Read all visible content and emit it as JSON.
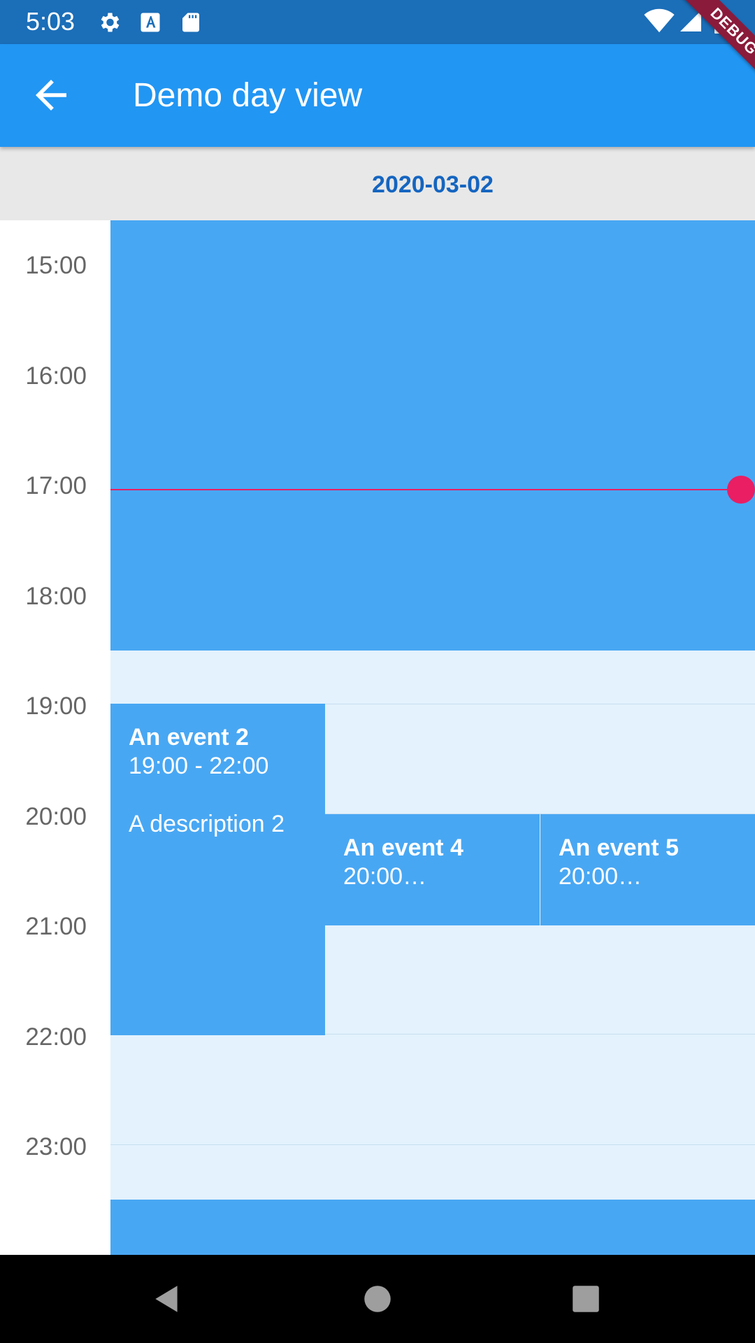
{
  "status_bar": {
    "time": "5:03",
    "icons": [
      "gear-icon",
      "text-a-icon",
      "sd-card-icon",
      "wifi-icon",
      "signal-icon",
      "battery-icon"
    ]
  },
  "debug_banner": "DEBUG",
  "app_bar": {
    "title": "Demo day view",
    "back_icon": "arrow-back-icon",
    "color": "#2196f3"
  },
  "day_view": {
    "date": "2020-03-02",
    "hours": [
      "15:00",
      "16:00",
      "17:00",
      "18:00",
      "19:00",
      "20:00",
      "21:00",
      "22:00",
      "23:00"
    ],
    "events": [
      {
        "title": "An event 2",
        "time": "19:00 - 22:00",
        "description": "A description 2"
      },
      {
        "title": "An event 4",
        "time": "20:00…"
      },
      {
        "title": "An event 5",
        "time": "20:00…"
      }
    ],
    "colors": {
      "event": "#48a7f3",
      "background": "#e3f2fd",
      "current_time_indicator": "#e91e63",
      "date_text": "#1565c0"
    }
  },
  "nav_bar": {
    "buttons": [
      "back-triangle-icon",
      "home-circle-icon",
      "recents-square-icon"
    ]
  }
}
